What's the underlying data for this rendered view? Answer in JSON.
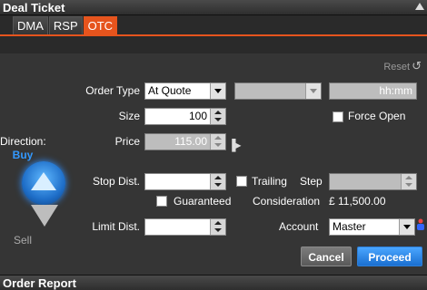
{
  "window": {
    "title": "Deal Ticket"
  },
  "tabs": [
    {
      "label": "DMA",
      "active": false
    },
    {
      "label": "RSP",
      "active": false
    },
    {
      "label": "OTC",
      "active": true
    }
  ],
  "reset": {
    "label": "Reset",
    "icon": "refresh-icon"
  },
  "direction": {
    "label": "Direction:",
    "value": "Buy",
    "sell_label": "Sell"
  },
  "order_type": {
    "label": "Order Type",
    "value": "At Quote",
    "time_placeholder": "hh:mm"
  },
  "size": {
    "label": "Size",
    "value": "100"
  },
  "force_open": {
    "label": "Force Open",
    "checked": false
  },
  "price": {
    "label": "Price",
    "value": "115.00"
  },
  "stop": {
    "label": "Stop Dist.",
    "value": "",
    "trailing_label": "Trailing",
    "step_label": "Step",
    "step_value": ""
  },
  "guaranteed": {
    "label": "Guaranteed",
    "checked": false
  },
  "consideration": {
    "label": "Consideration",
    "value": "£ 11,500.00"
  },
  "limit": {
    "label": "Limit Dist.",
    "value": ""
  },
  "account": {
    "label": "Account",
    "value": "Master"
  },
  "buttons": {
    "cancel": "Cancel",
    "proceed": "Proceed"
  },
  "report": {
    "title": "Order Report"
  },
  "colors": {
    "accent": "#e6541d",
    "buy": "#3399ff",
    "panel": "#353535"
  }
}
